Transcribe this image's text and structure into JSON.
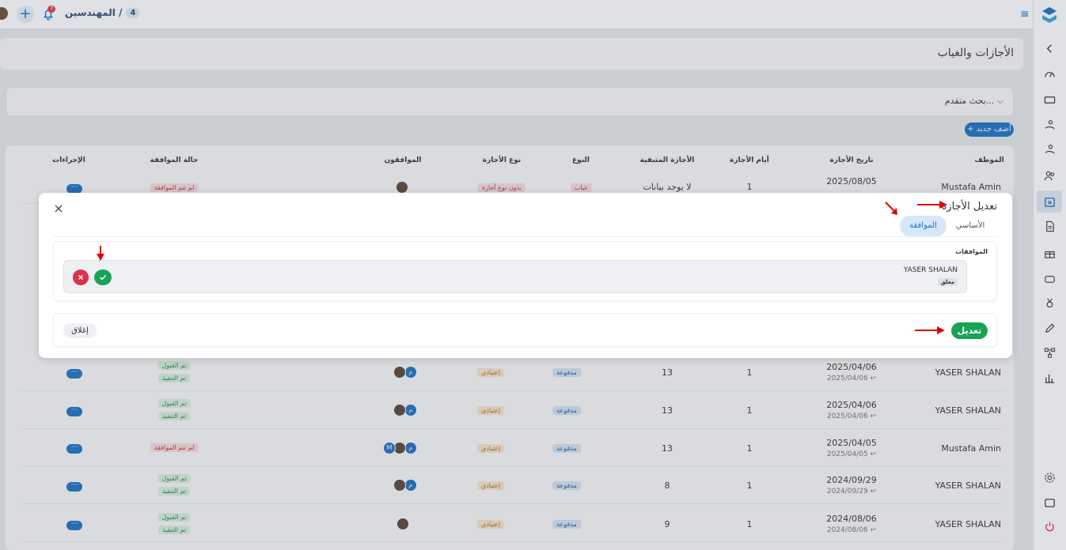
{
  "topbar": {
    "breadcrumb": "المهندسين /",
    "count": "4",
    "notifications_badge": "7"
  },
  "page": {
    "title": "الأجازات والغياب",
    "search_label": "بحث متقدم...",
    "add_button": "+ أضف جديد"
  },
  "table": {
    "headers": {
      "employee": "الموظف",
      "date": "تاريخ الأجازة",
      "days": "أيام الأجازة",
      "remaining": "الأجازة المتبقية",
      "type": "النوع",
      "leave_type": "نوع الأجازة",
      "approvers": "الموافقون",
      "approval_status": "حالة الموافقة",
      "actions": "الإجراءات"
    },
    "rows": [
      {
        "employee": "Mustafa Amin",
        "date": "2025/08/05",
        "date_sub": "2025/08/05",
        "days": "1",
        "remaining": "لا يوجد بيانات",
        "type": "غياب",
        "leave_type": "بدون نوع أجازة",
        "status1": "لم تتم الموافقة",
        "status2": "",
        "actions": "···"
      },
      {
        "employee": "YASER SHALAN",
        "date": "2025/04/06",
        "date_sub": "2025/04/06 ↩",
        "days": "1",
        "remaining": "13",
        "type": "مدفوعة",
        "leave_type": "إعتيادي",
        "status1": "تم القبول",
        "status2": "تم التنفيذ",
        "actions": "···"
      },
      {
        "employee": "YASER SHALAN",
        "date": "2025/04/06",
        "date_sub": "2025/04/06 ↩",
        "days": "1",
        "remaining": "13",
        "type": "مدفوعة",
        "leave_type": "إعتيادي",
        "status1": "تم القبول",
        "status2": "تم التنفيذ",
        "actions": "···"
      },
      {
        "employee": "Mustafa Amin",
        "date": "2025/04/05",
        "date_sub": "2025/04/05 ↩",
        "days": "1",
        "remaining": "13",
        "type": "مدفوعة",
        "leave_type": "إعتيادي",
        "status1": "لم تتم الموافقة",
        "status2": "",
        "actions": "···"
      },
      {
        "employee": "YASER SHALAN",
        "date": "2024/09/29",
        "date_sub": "2024/09/29 ↩",
        "days": "1",
        "remaining": "8",
        "type": "مدفوعة",
        "leave_type": "إعتيادي",
        "status1": "تم القبول",
        "status2": "تم التنفيذ",
        "actions": "···"
      },
      {
        "employee": "YASER SHALAN",
        "date": "2024/08/06",
        "date_sub": "2024/08/06 ↩",
        "days": "1",
        "remaining": "9",
        "type": "مدفوعة",
        "leave_type": "إعتيادي",
        "status1": "تم القبول",
        "status2": "تم التنفيذ",
        "actions": "···"
      }
    ],
    "approver_initials": {
      "m": "م",
      "M": "M"
    }
  },
  "modal": {
    "title": "تعديل الأجازة",
    "tab_basic": "الأساسي",
    "tab_approval": "الموافقة",
    "approvals_label": "الموافقات",
    "approver_name": "YASER SHALAN",
    "approver_status": "معلق",
    "close_button": "إغلاق",
    "edit_button": "تعديل"
  },
  "colors": {
    "accent": "#1a73c8",
    "success": "#1aa257",
    "danger": "#d9344c",
    "annotation_arrow": "#e00000"
  },
  "icons": [
    "logo-icon",
    "menu-icon",
    "plus-icon",
    "bell-icon",
    "chevron-left-icon",
    "dashboard-icon",
    "ticket-icon",
    "hand-coin-icon",
    "hand-coin-icon",
    "users-icon",
    "calendar-x-icon",
    "document-icon",
    "gift-icon",
    "car-icon",
    "medal-icon",
    "pen-icon",
    "workflow-icon",
    "chart-icon",
    "settings-icon",
    "window-icon",
    "power-icon",
    "close-icon",
    "check-icon",
    "x-icon"
  ]
}
